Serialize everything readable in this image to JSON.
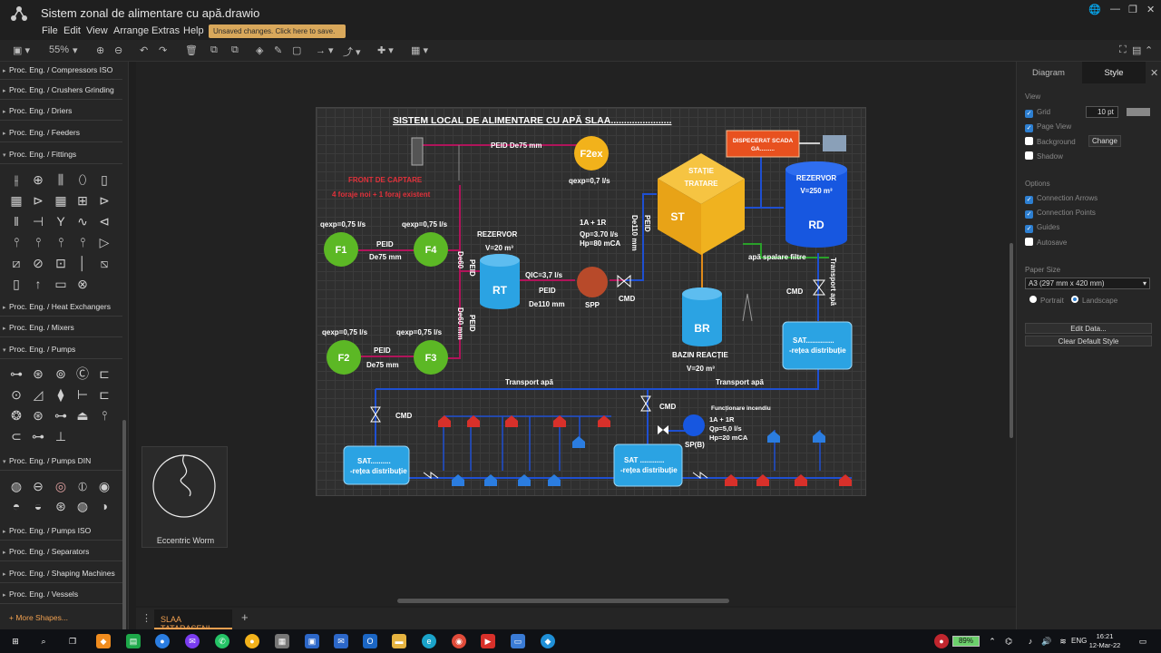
{
  "app": {
    "title": "Sistem zonal de alimentare cu apă.drawio",
    "menus": [
      "File",
      "Edit",
      "View",
      "Arrange",
      "Extras",
      "Help"
    ],
    "unsaved": "Unsaved changes. Click here to save."
  },
  "toolbar": {
    "zoom": "55%"
  },
  "sidebar": {
    "categories": [
      "Proc. Eng. / Compressors ISO",
      "Proc. Eng. / Crushers Grinding",
      "Proc. Eng. / Driers",
      "Proc. Eng. / Feeders",
      "Proc. Eng. / Fittings",
      "Proc. Eng. / Heat Exchangers",
      "Proc. Eng. / Mixers",
      "Proc. Eng. / Pumps",
      "Proc. Eng. / Pumps DIN",
      "Proc. Eng. / Pumps ISO",
      "Proc. Eng. / Separators",
      "Proc. Eng. / Shaping Machines",
      "Proc. Eng. / Vessels"
    ],
    "more_shapes": "More Shapes..."
  },
  "preview": {
    "label": "Eccentric Worm"
  },
  "diagram": {
    "title": "SISTEM LOCAL DE ALIMENTARE CU APĂ SLAA.......................",
    "front_captare": "FRONT DE CAPTARE",
    "forage": "4 foraje noi + 1 foraj existent",
    "peid_de75_top": "PEID De75 mm",
    "f2ex": "F2ex",
    "qexp_07": "qexp=0,7 l/s",
    "qexp_f1": "qexp=0,75 l/s",
    "qexp_f4": "qexp=0,75 l/s",
    "qexp_f2": "qexp=0,75 l/s",
    "qexp_f3": "qexp=0,75 l/s",
    "f1": "F1",
    "f2": "F2",
    "f3": "F3",
    "f4": "F4",
    "peid1": "PEID",
    "de75_1": "De75 mm",
    "peid2": "PEID",
    "de75_2": "De75 mm",
    "de60_a": "De60",
    "peid_v1": "PEID",
    "de60_b": "De60 mm",
    "peid_v2": "PEID",
    "rezervor_rt": "REZERVOR",
    "v20_rt": "V=20 m³",
    "rt": "RT",
    "qic": "QIC=3,7 l/s",
    "peid3": "PEID",
    "de110_1": "De110 mm",
    "spp": "SPP",
    "pump_1a": "1A + 1R",
    "qp": "Qp=3.70 l/s",
    "hp": "Hp=80 mCA",
    "de110_v": "De110 mm",
    "peid_v3": "PEID",
    "cmd1": "CMD",
    "statie": "STAȚIE",
    "tratare": "TRATARE",
    "st": "ST",
    "dispecerat": "DISPECERAT SCADA",
    "dispecerat2": "GA.........",
    "rezervor_rd": "REZERVOR",
    "v250": "V=250 m³",
    "rd": "RD",
    "apa_spalare": "apă spalare filtre",
    "transport_v": "Transport apă",
    "cmd2": "CMD",
    "br": "BR",
    "bazin": "BAZIN REACȚIE",
    "v20_br": "V=20 m³",
    "sat1": "SAT..............",
    "retea1": "-rețea distribuție",
    "transport1": "Transport apă",
    "transport2": "Transport apă",
    "cmd3": "CMD",
    "cmd4": "CMD",
    "incendiu": "Funcționare incendiu",
    "pump2_1a": "1A + 1R",
    "qp2": "Qp=5,0 l/s",
    "hp2": "Hp=20 mCA",
    "spb": "SP(B)",
    "sat2": "SAT..........",
    "retea2": "-rețea distribuție",
    "sat3": "SAT ............",
    "retea3": "-rețea distribuție"
  },
  "pagetabs": {
    "active": "SLAA TATARASENI"
  },
  "rightpanel": {
    "tab_diagram": "Diagram",
    "tab_style": "Style",
    "view": "View",
    "grid": "Grid",
    "grid_size": "10 pt",
    "page_view": "Page View",
    "background": "Background",
    "change": "Change",
    "shadow": "Shadow",
    "options": "Options",
    "connection_arrows": "Connection Arrows",
    "connection_points": "Connection Points",
    "guides": "Guides",
    "autosave": "Autosave",
    "paper_size": "Paper Size",
    "paper_value": "A3 (297 mm x 420 mm)",
    "portrait": "Portrait",
    "landscape": "Landscape",
    "edit_data": "Edit Data...",
    "clear_style": "Clear Default Style"
  },
  "taskbar": {
    "battery": "89%",
    "lang": "ENG",
    "time": "16:21",
    "date": "12-Mar-22"
  }
}
